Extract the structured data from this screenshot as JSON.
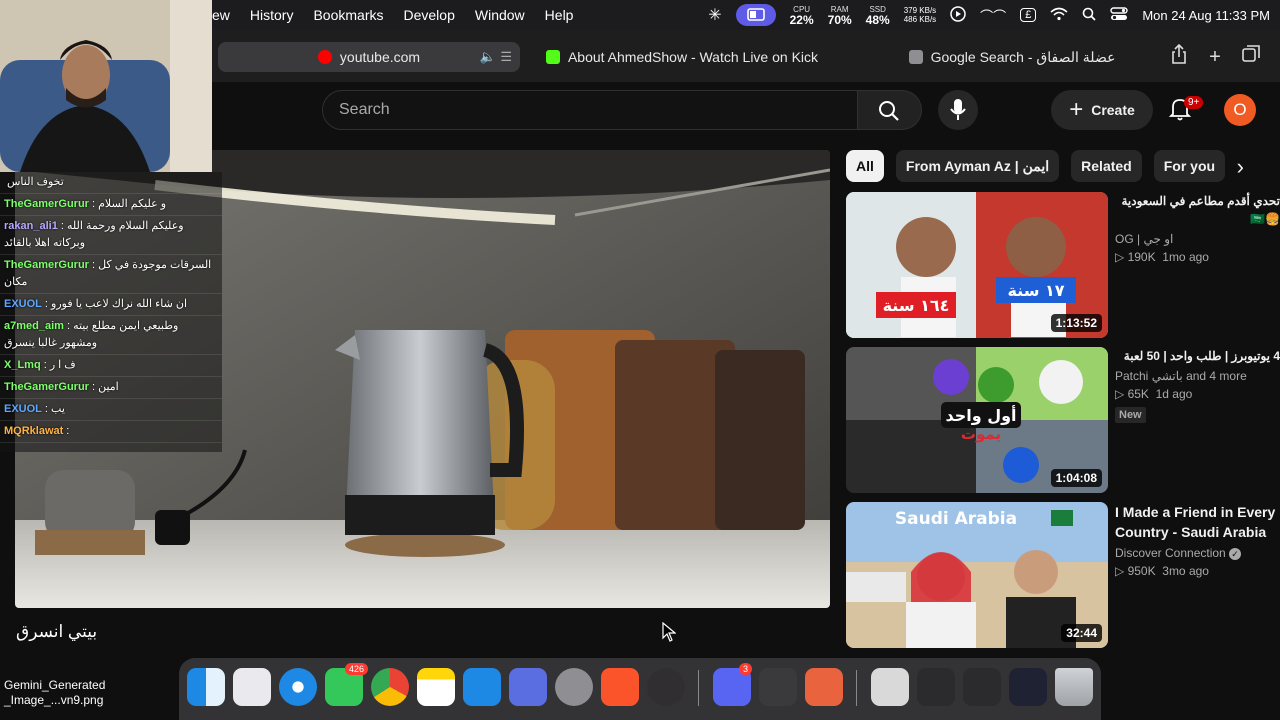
{
  "menubar": {
    "items": [
      "ew",
      "History",
      "Bookmarks",
      "Develop",
      "Window",
      "Help"
    ],
    "cpu_label": "CPU",
    "cpu_value": "22%",
    "ram_label": "RAM",
    "ram_value": "70%",
    "ssd_label": "SSD",
    "ssd_value": "48%",
    "net_up": "379 KB/s",
    "net_down": "486 KB/s",
    "input_source": "£",
    "datetime": "Mon 24 Aug  11:33 PM"
  },
  "tabs": [
    {
      "label": "youtube.com",
      "favicon_color": "#ff0000"
    },
    {
      "label": "About AhmedShow - Watch Live on Kick",
      "favicon_color": "#53fc18"
    },
    {
      "label": "Google Search - عضلة الصفاق",
      "favicon_color": "#8e8e93"
    }
  ],
  "header": {
    "search_placeholder": "Search",
    "create_label": "Create",
    "notification_count": "9+",
    "avatar_letter": "O"
  },
  "chat": [
    {
      "user": "",
      "text": "تخوف الناس",
      "color": "#8fa7ff"
    },
    {
      "user": "TheGamerGurur",
      "text": ": و عليكم السلام",
      "color": "#7dff6b"
    },
    {
      "user": "rakan_ali1",
      "text": ": وعليكم السلام ورحمة الله وبركاته اهلا بالقائد",
      "color": "#b9a7ff"
    },
    {
      "user": "TheGamerGurur",
      "text": ": السرقات موجودة في كل مكان",
      "color": "#7dff6b"
    },
    {
      "user": "EXUOL",
      "text": ": ان شاء الله نراك لاعب يا فورو",
      "color": "#5fa8ff"
    },
    {
      "user": "a7med_aim",
      "text": ": وطبيعي ايمن مطلع بيته ومشهور غالبا ينسرق",
      "color": "#7dff6b"
    },
    {
      "user": "X_Lmq",
      "text": ": ف ا ر",
      "color": "#7dff6b"
    },
    {
      "user": "TheGamerGurur",
      "text": ": امين",
      "color": "#7dff6b"
    },
    {
      "user": "EXUOL",
      "text": ": يب",
      "color": "#5fa8ff"
    },
    {
      "user": "MQRklawat",
      "text": ":",
      "color": "#ffb347"
    }
  ],
  "video": {
    "title": "بيتي انسرق"
  },
  "chips": [
    "All",
    "From Ayman Az | ايمن",
    "Related",
    "For you"
  ],
  "recommended": [
    {
      "title": "تحدي أقدم مطاعم في السعودية 🍔🇸🇦",
      "channel": "OG | او جي",
      "views": "190K",
      "age": "1mo ago",
      "duration": "1:13:52",
      "thumb_text_left": "١٦٤ سنة",
      "thumb_text_right": "١٧ سنة",
      "badge": ""
    },
    {
      "title": "4 يوتيوبرز | طلب واحد | 50 لعبة",
      "channel": "Patchi باتشي and 4 more",
      "views": "65K",
      "age": "1d ago",
      "duration": "1:04:08",
      "thumb_text_left": "أول واحد",
      "thumb_text_right": "يموت",
      "badge": "New"
    },
    {
      "title": "I Made a Friend in Every Country - Saudi Arabia",
      "channel": "Discover Connection",
      "views": "950K",
      "age": "3mo ago",
      "duration": "32:44",
      "thumb_text_left": "Saudi Arabia",
      "thumb_text_right": "",
      "badge": ""
    }
  ],
  "dock": {
    "messages_badge": "426",
    "discord_badge": "3"
  },
  "desktop": {
    "file_line1": "Gemini_Generated",
    "file_line2": "_Image_...vn9.png"
  }
}
